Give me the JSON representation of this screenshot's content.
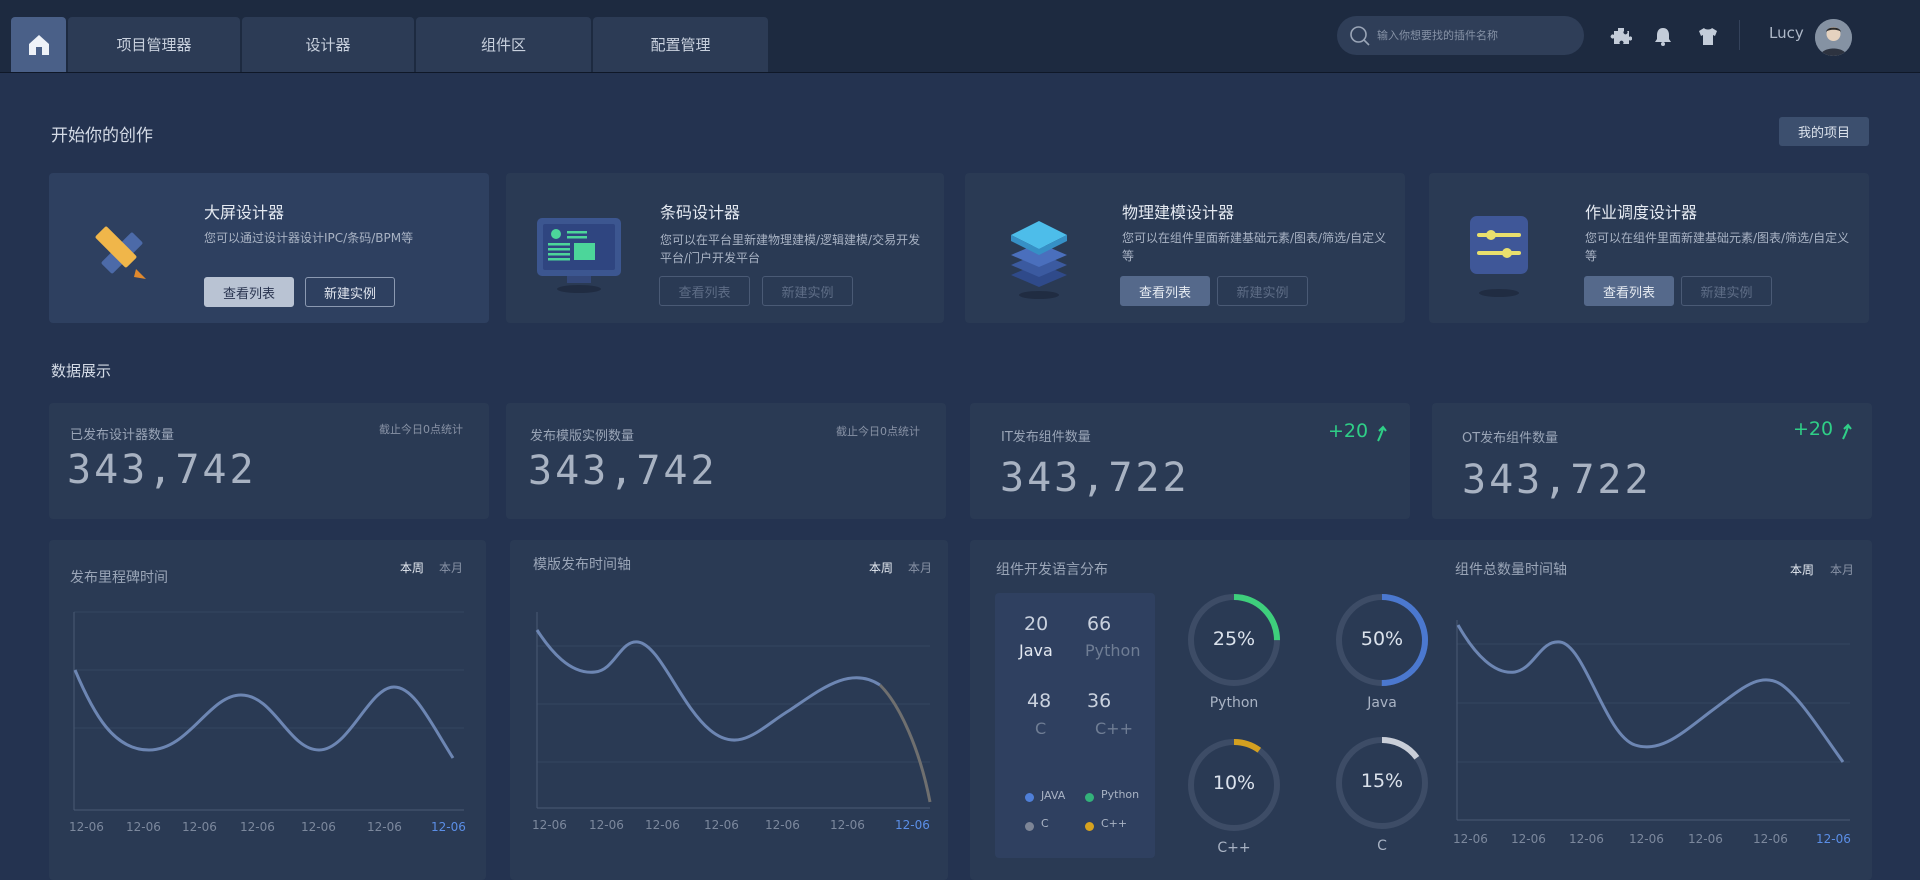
{
  "nav": {
    "tabs": [
      "项目管理器",
      "设计器",
      "组件区",
      "配置管理"
    ],
    "search_placeholder": "输入你想要找的插件名称",
    "user_name": "Lucy"
  },
  "create_section": {
    "title": "开始你的创作",
    "my_projects_label": "我的项目",
    "cards": [
      {
        "title": "大屏设计器",
        "desc": "您可以通过设计器设计IPC/条码/BPM等",
        "view_label": "查看列表",
        "new_label": "新建实例",
        "icon": "pencil-ruler-icon"
      },
      {
        "title": "条码设计器",
        "desc": "您可以在平台里新建物理建模/逻辑建模/交易开发平台/门户开发平台",
        "view_label": "查看列表",
        "new_label": "新建实例",
        "icon": "monitor-icon"
      },
      {
        "title": "物理建模设计器",
        "desc": "您可以在组件里面新建基础元素/图表/筛选/自定义等",
        "view_label": "查看列表",
        "new_label": "新建实例",
        "icon": "layers-icon"
      },
      {
        "title": "作业调度设计器",
        "desc": "您可以在组件里面新建基础元素/图表/筛选/自定义等",
        "view_label": "查看列表",
        "new_label": "新建实例",
        "icon": "sliders-icon"
      }
    ]
  },
  "data_section": {
    "title": "数据展示",
    "stats": [
      {
        "label": "已发布设计器数量",
        "note": "截止今日0点统计",
        "value": "343,742"
      },
      {
        "label": "发布模版实例数量",
        "note": "截止今日0点统计",
        "value": "343,742"
      },
      {
        "label": "IT发布组件数量",
        "delta": "+20",
        "value": "343,722"
      },
      {
        "label": "OT发布组件数量",
        "delta": "+20",
        "value": "343,722"
      }
    ]
  },
  "periods": {
    "week": "本周",
    "month": "本月"
  },
  "charts": {
    "milestone": {
      "title": "发布里程碑时间",
      "x_labels": [
        "12-06",
        "12-06",
        "12-06",
        "12-06",
        "12-06",
        "12-06",
        "12-06"
      ]
    },
    "template_timeline": {
      "title": "模版发布时间轴",
      "x_labels": [
        "12-06",
        "12-06",
        "12-06",
        "12-06",
        "12-06",
        "12-06",
        "12-06"
      ]
    },
    "language": {
      "title": "组件开发语言分布",
      "counts": [
        {
          "num": "20",
          "name": "Java"
        },
        {
          "num": "66",
          "name": "Python"
        },
        {
          "num": "48",
          "name": "C"
        },
        {
          "num": "36",
          "name": "C++"
        }
      ],
      "legend": [
        {
          "name": "JAVA",
          "color": "#4f7fd8"
        },
        {
          "name": "Python",
          "color": "#33b27a"
        },
        {
          "name": "C",
          "color": "#7d8596"
        },
        {
          "name": "C++",
          "color": "#d6a21f"
        }
      ],
      "donuts": [
        {
          "pct": "25%",
          "value": 0.25,
          "name": "Python",
          "color": "#3ecf7c"
        },
        {
          "pct": "50%",
          "value": 0.5,
          "name": "Java",
          "color": "#4b78cf"
        },
        {
          "pct": "10%",
          "value": 0.1,
          "name": "C++",
          "color": "#d4a020"
        },
        {
          "pct": "15%",
          "value": 0.15,
          "name": "C",
          "color": "#c9ced8"
        }
      ]
    },
    "component_total": {
      "title": "组件总数量时间轴",
      "x_labels": [
        "12-06",
        "12-06",
        "12-06",
        "12-06",
        "12-06",
        "12-06",
        "12-06"
      ]
    }
  }
}
